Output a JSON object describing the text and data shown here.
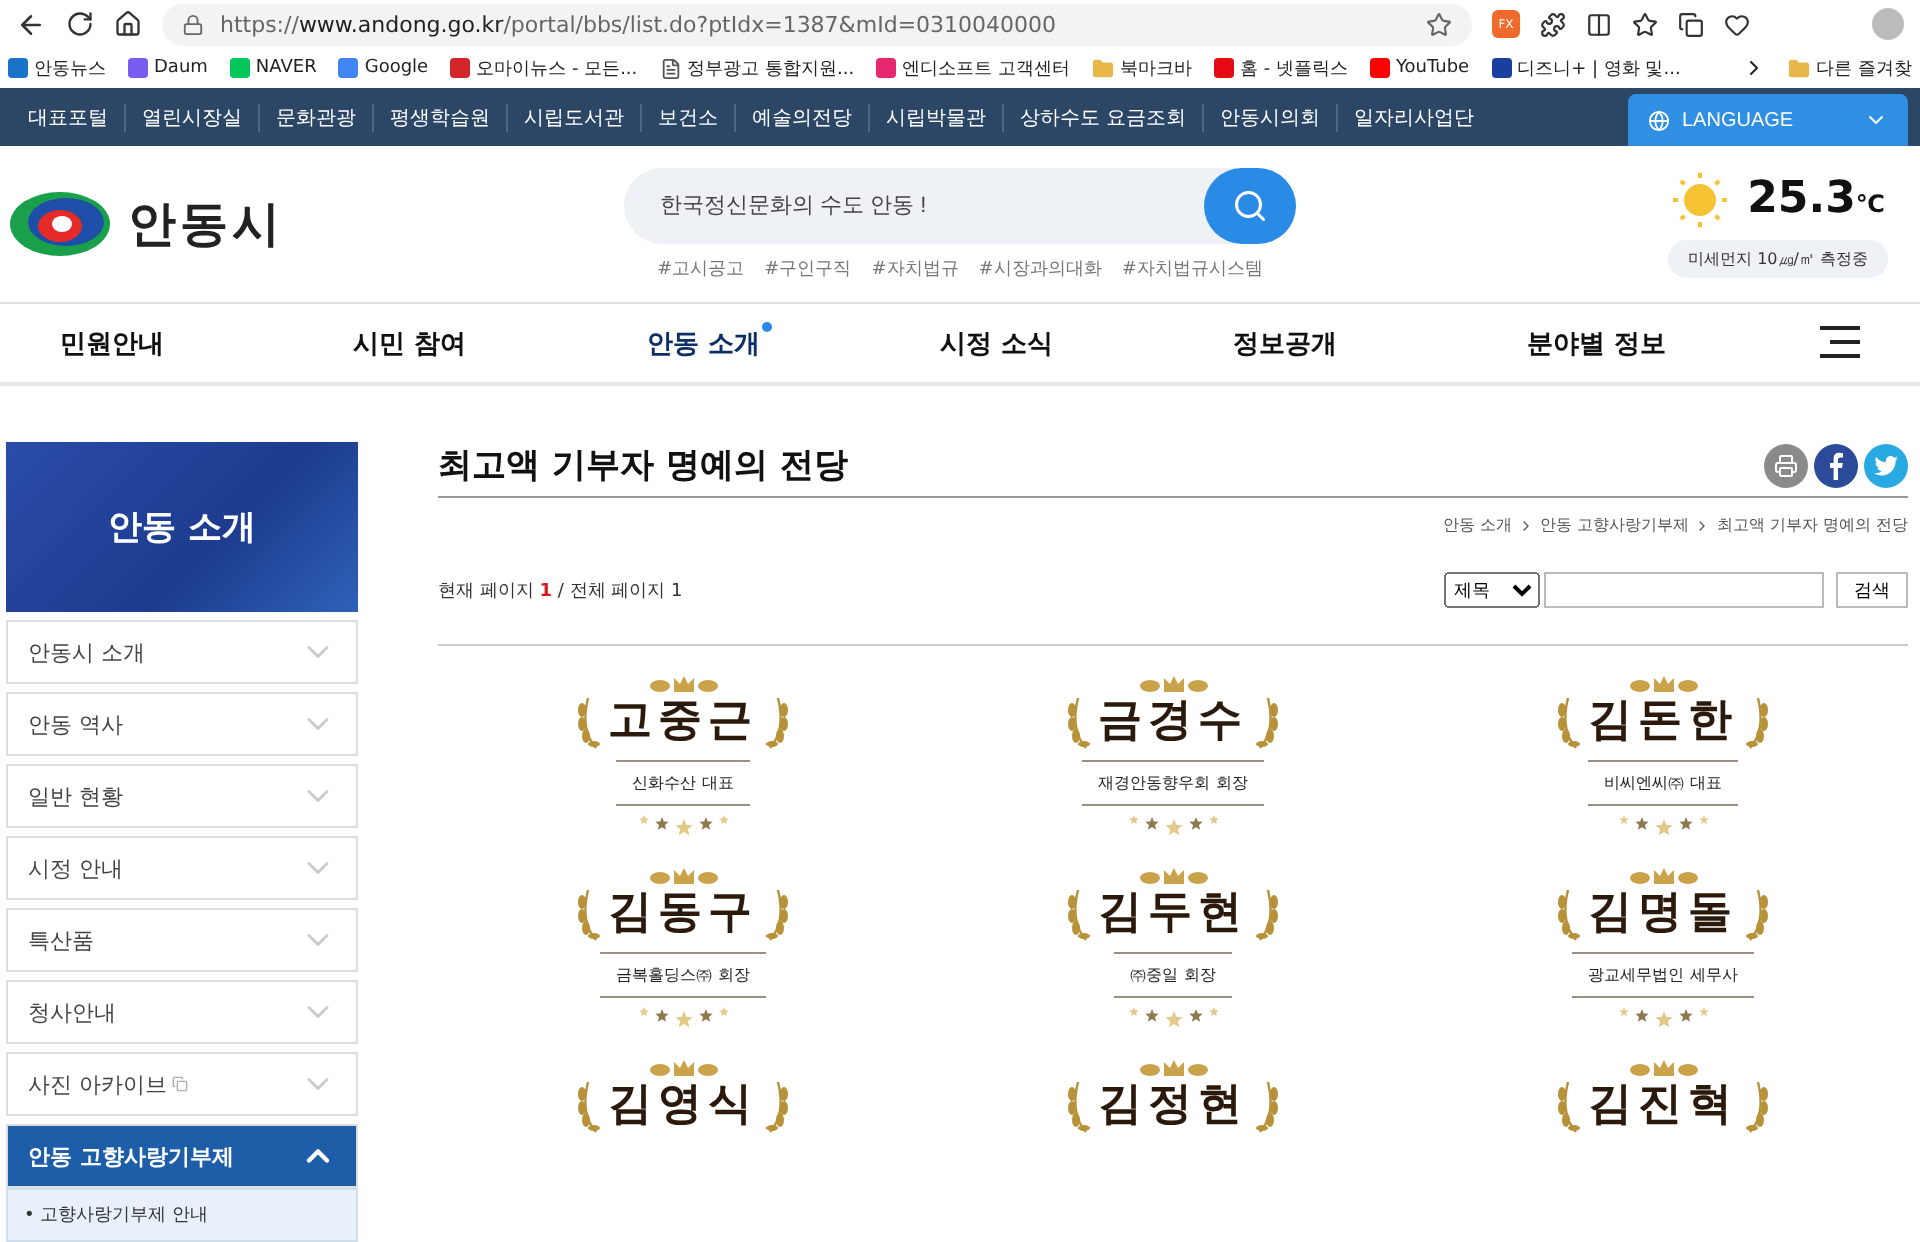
{
  "browser": {
    "url_prefix": "https://",
    "url_host": "www.andong.go.kr",
    "url_path": "/portal/bbs/list.do?ptIdx=1387&mId=0310040000",
    "extension_badge": "FX"
  },
  "bookmarks": [
    {
      "label": "안동뉴스",
      "kind": "site",
      "color": "#1a73c8"
    },
    {
      "label": "Daum",
      "kind": "site",
      "color": "#7a5cf0"
    },
    {
      "label": "NAVER",
      "kind": "site",
      "color": "#03c75a"
    },
    {
      "label": "Google",
      "kind": "site",
      "color": "#4285f4"
    },
    {
      "label": "오마이뉴스 - 모든...",
      "kind": "site",
      "color": "#d2262a"
    },
    {
      "label": "정부광고 통합지원...",
      "kind": "page"
    },
    {
      "label": "엔디소프트 고객센터",
      "kind": "site",
      "color": "#e6266e"
    },
    {
      "label": "북마크바",
      "kind": "folder"
    },
    {
      "label": "홈 - 넷플릭스",
      "kind": "site",
      "color": "#e50914"
    },
    {
      "label": "YouTube",
      "kind": "site",
      "color": "#ff0000"
    },
    {
      "label": "디즈니+ | 영화 및...",
      "kind": "site",
      "color": "#1b3fa0"
    }
  ],
  "other_bookmarks": "다른 즐겨찾",
  "top_links": [
    "대표포털",
    "열린시장실",
    "문화관광",
    "평생학습원",
    "시립도서관",
    "보건소",
    "예술의전당",
    "시립박물관",
    "상하수도 요금조회",
    "안동시의회",
    "일자리사업단"
  ],
  "language_button": "LANGUAGE",
  "logo_text": "안동시",
  "search": {
    "placeholder": "한국정신문화의 수도 안동 !"
  },
  "hashtags": [
    "#고시공고",
    "#구인구직",
    "#자치법규",
    "#시장과의대화",
    "#자치법규시스템"
  ],
  "weather": {
    "temperature": "25.3",
    "unit": "℃",
    "dust": "미세먼지 10㎍/㎥ 측정중"
  },
  "main_nav": [
    {
      "label": "민원안내",
      "selected": false
    },
    {
      "label": "시민 참여",
      "selected": false
    },
    {
      "label": "안동 소개",
      "selected": true
    },
    {
      "label": "시정 소식",
      "selected": false
    },
    {
      "label": "정보공개",
      "selected": false
    },
    {
      "label": "분야별 정보",
      "selected": false
    }
  ],
  "sidebar": {
    "title": "안동 소개",
    "items": [
      {
        "label": "안동시 소개",
        "expanded": false,
        "external": false
      },
      {
        "label": "안동 역사",
        "expanded": false,
        "external": false
      },
      {
        "label": "일반 현황",
        "expanded": false,
        "external": false
      },
      {
        "label": "시정 안내",
        "expanded": false,
        "external": false
      },
      {
        "label": "특산품",
        "expanded": false,
        "external": false
      },
      {
        "label": "청사안내",
        "expanded": false,
        "external": false
      },
      {
        "label": "사진 아카이브",
        "expanded": false,
        "external": true
      },
      {
        "label": "안동 고향사랑기부제",
        "expanded": true,
        "external": false,
        "children": [
          {
            "label": "• 고향사랑기부제 안내"
          }
        ]
      }
    ]
  },
  "page_title": "최고액 기부자 명예의 전당",
  "breadcrumb": [
    "안동 소개",
    "안동 고향사랑기부제",
    "최고액 기부자 명예의 전당"
  ],
  "paging": {
    "current_label": "현재 페이지",
    "current": "1",
    "total_label": "/ 전체 페이지",
    "total": "1"
  },
  "board_search": {
    "field": "제목",
    "button": "검색"
  },
  "donors": [
    {
      "name": "고중근",
      "title": "신화수산 대표"
    },
    {
      "name": "금경수",
      "title": "재경안동향우회 회장"
    },
    {
      "name": "김돈한",
      "title": "비씨엔씨㈜ 대표"
    },
    {
      "name": "김동구",
      "title": "금복홀딩스㈜ 회장"
    },
    {
      "name": "김두현",
      "title": "㈜중일 회장"
    },
    {
      "name": "김명돌",
      "title": "광교세무법인 세무사"
    },
    {
      "name": "김영식"
    },
    {
      "name": "김정현"
    },
    {
      "name": "김진혁"
    }
  ]
}
